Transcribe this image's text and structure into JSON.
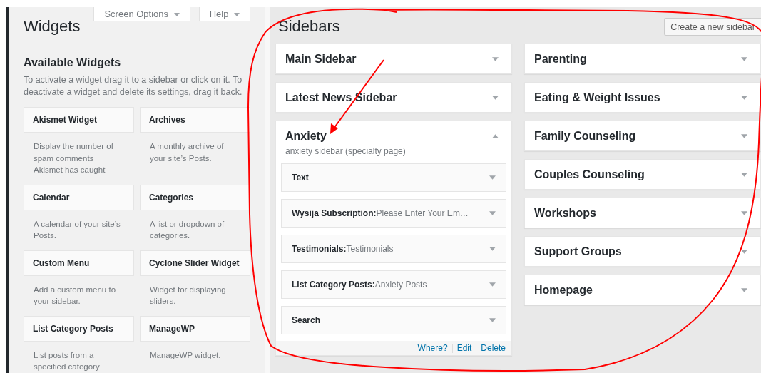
{
  "header": {
    "screen_options": "Screen Options",
    "help": "Help",
    "title": "Widgets"
  },
  "available": {
    "title": "Available Widgets",
    "description": "To activate a widget drag it to a sidebar or click on it. To deactivate a widget and delete its settings, drag it back.",
    "widgets": [
      {
        "name": "Akismet Widget",
        "description": "Display the number of spam comments Akismet has caught"
      },
      {
        "name": "Archives",
        "description": "A monthly archive of your site’s Posts."
      },
      {
        "name": "Calendar",
        "description": "A calendar of your site’s Posts."
      },
      {
        "name": "Categories",
        "description": "A list or dropdown of categories."
      },
      {
        "name": "Custom Menu",
        "description": "Add a custom menu to your sidebar."
      },
      {
        "name": "Cyclone Slider Widget",
        "description": "Widget for displaying sliders."
      },
      {
        "name": "List Category Posts",
        "description": "List posts from a specified category"
      },
      {
        "name": "ManageWP",
        "description": "ManageWP widget."
      }
    ]
  },
  "sidebars": {
    "title": "Sidebars",
    "create_button": "Create a new sidebar",
    "columns": [
      [
        {
          "name": "Main Sidebar",
          "expanded": false
        },
        {
          "name": "Latest News Sidebar",
          "expanded": false
        },
        {
          "name": "Anxiety",
          "expanded": true,
          "description": "anxiety sidebar (specialty page)",
          "widgets": [
            {
              "title": "Text"
            },
            {
              "title": "Wysija Subscription:",
              "detail": "Please Enter Your Em…"
            },
            {
              "title": "Testimonials:",
              "detail": "Testimonials"
            },
            {
              "title": "List Category Posts:",
              "detail": "Anxiety Posts"
            },
            {
              "title": "Search"
            }
          ],
          "actions": [
            "Where?",
            "Edit",
            "Delete"
          ]
        }
      ],
      [
        {
          "name": "Parenting",
          "expanded": false
        },
        {
          "name": "Eating & Weight Issues",
          "expanded": false
        },
        {
          "name": "Family Counseling",
          "expanded": false
        },
        {
          "name": "Couples Counseling",
          "expanded": false
        },
        {
          "name": "Workshops",
          "expanded": false
        },
        {
          "name": "Support Groups",
          "expanded": false
        },
        {
          "name": "Homepage",
          "expanded": false
        }
      ]
    ]
  }
}
